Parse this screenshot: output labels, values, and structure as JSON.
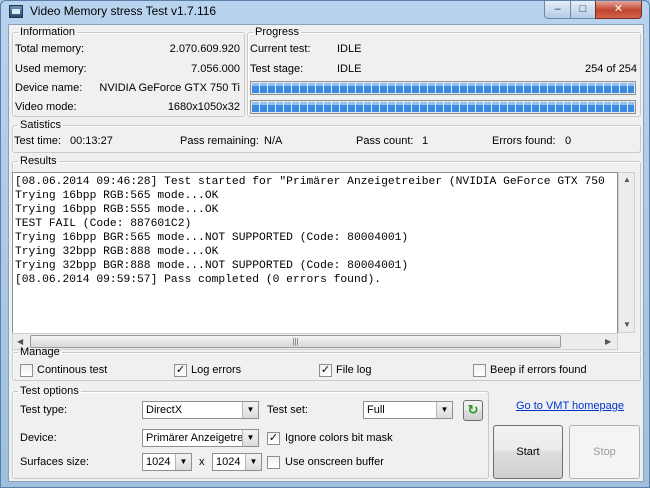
{
  "window": {
    "title": "Video Memory stress Test v1.7.116",
    "minimize_icon": "minimize-icon",
    "maximize_icon": "maximize-icon",
    "close_icon": "close-icon",
    "minimize_glyph": "–",
    "maximize_glyph": "□",
    "close_glyph": "✕"
  },
  "information": {
    "legend": "Information",
    "rows": [
      {
        "label": "Total memory:",
        "value": "2.070.609.920"
      },
      {
        "label": "Used memory:",
        "value": "7.056.000"
      },
      {
        "label": "Device name:",
        "value": "NVIDIA GeForce GTX 750 Ti"
      },
      {
        "label": "Video mode:",
        "value": "1680x1050x32"
      }
    ]
  },
  "progress": {
    "legend": "Progress",
    "current_test_label": "Current test:",
    "current_test_value": "IDLE",
    "test_stage_label": "Test stage:",
    "test_stage_value": "IDLE",
    "stage_count": "254 of 254",
    "bar1_fraction": 1.0,
    "bar2_fraction": 1.0
  },
  "statistics": {
    "legend": "Satistics",
    "test_time_label": "Test time:",
    "test_time_value": "00:13:27",
    "pass_remaining_label": "Pass remaining:",
    "pass_remaining_value": "N/A",
    "pass_count_label": "Pass count:",
    "pass_count_value": "1",
    "errors_found_label": "Errors found:",
    "errors_found_value": "0"
  },
  "results": {
    "legend": "Results",
    "lines": [
      "[08.06.2014 09:46:28] Test started for \"Primärer Anzeigetreiber (NVIDIA GeForce GTX 750",
      "Trying 16bpp RGB:565 mode...OK",
      "Trying 16bpp RGB:555 mode...OK",
      "TEST FAIL (Code: 887601C2)",
      "Trying 16bpp BGR:565 mode...NOT SUPPORTED (Code: 80004001)",
      "Trying 32bpp RGB:888 mode...OK",
      "Trying 32bpp BGR:888 mode...NOT SUPPORTED (Code: 80004001)",
      "[08.06.2014 09:59:57] Pass completed (0 errors found)."
    ],
    "scroll_up_glyph": "▲",
    "scroll_down_glyph": "▼",
    "scroll_left_glyph": "◀",
    "scroll_right_glyph": "▶",
    "thumb_grip": "|||"
  },
  "manage": {
    "legend": "Manage",
    "continous_test": {
      "label": "Continous test",
      "checked": false
    },
    "log_errors": {
      "label": "Log errors",
      "checked": true
    },
    "file_log": {
      "label": "File log",
      "checked": true
    },
    "beep_if_errors": {
      "label": "Beep if errors found",
      "checked": false
    },
    "check_glyph": "✓"
  },
  "test_options": {
    "legend": "Test options",
    "test_type_label": "Test type:",
    "test_type_value": "DirectX",
    "test_set_label": "Test set:",
    "test_set_value": "Full",
    "refresh_icon": "refresh-icon",
    "refresh_glyph": "↻",
    "device_label": "Device:",
    "device_value": "Primärer Anzeigetrei",
    "ignore_colors": {
      "label": "Ignore colors bit mask",
      "checked": true
    },
    "surfaces_label": "Surfaces size:",
    "surface_width": "1024",
    "times_sign": "x",
    "surface_height": "1024",
    "onscreen_buffer": {
      "label": "Use onscreen buffer",
      "checked": false
    },
    "dropdown_glyph": "▼"
  },
  "actions": {
    "homepage_link": "Go to VMT homepage",
    "start_label": "Start",
    "stop_label": "Stop"
  }
}
